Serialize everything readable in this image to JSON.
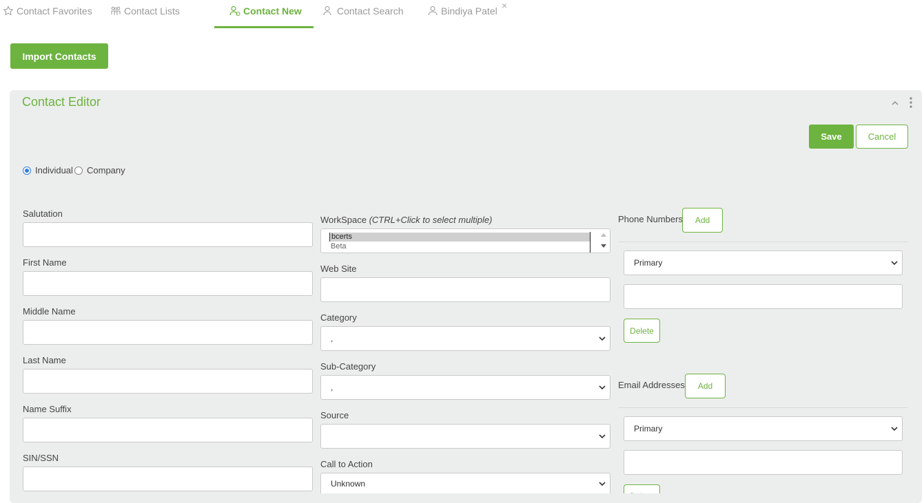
{
  "tabs": [
    {
      "label": "Contact Favorites",
      "icon": "star-icon"
    },
    {
      "label": "Contact Lists",
      "icon": "people-group-icon"
    },
    {
      "label": "Contact New",
      "icon": "person-add-icon"
    },
    {
      "label": "Contact Search",
      "icon": "person-search-icon"
    },
    {
      "label": "Bindiya Patel",
      "icon": "person-icon"
    }
  ],
  "tab_close": "×",
  "import_button": "Import Contacts",
  "editor": {
    "title": "Contact Editor",
    "save": "Save",
    "cancel": "Cancel",
    "contact_type": {
      "individual": "Individual",
      "company": "Company",
      "selected": "Individual"
    }
  },
  "left_fields": {
    "salutation": "Salutation",
    "first_name": "First Name",
    "middle_name": "Middle Name",
    "last_name": "Last Name",
    "name_suffix": "Name Suffix",
    "sin_ssn": "SIN/SSN"
  },
  "middle_fields": {
    "workspace_label": "WorkSpace",
    "workspace_hint": "(CTRL+Click to select multiple)",
    "workspace_options": [
      "bcerts",
      "Beta"
    ],
    "workspace_selected": "bcerts",
    "website": "Web Site",
    "category": "Category",
    "category_value": ",",
    "sub_category": "Sub-Category",
    "sub_category_value": ",",
    "source": "Source",
    "source_value": "",
    "call_to_action": "Call to Action",
    "call_to_action_value": "Unknown"
  },
  "right_fields": {
    "phone_numbers": "Phone Numbers",
    "phone_add": "Add",
    "phone_type": "Primary",
    "phone_delete": "Delete",
    "email_addresses": "Email Addresses",
    "email_add": "Add",
    "email_type": "Primary",
    "email_delete": "Delete"
  },
  "colors": {
    "accent": "#6db33f",
    "panel_bg": "#eceeed",
    "tab_inactive": "#9a9a9a"
  }
}
